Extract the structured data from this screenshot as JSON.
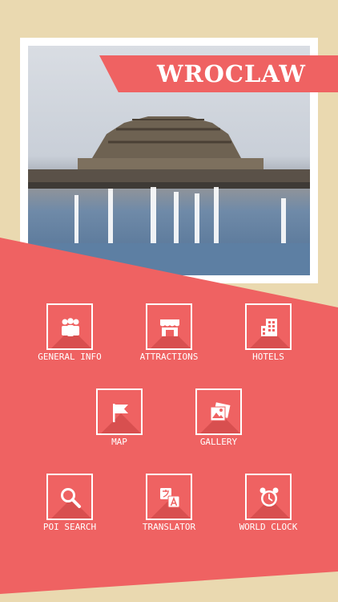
{
  "header": {
    "title": "WROCLAW"
  },
  "menu": {
    "general_info": "GENERAL INFO",
    "attractions": "ATTRACTIONS",
    "hotels": "HOTELS",
    "map": "MAP",
    "gallery": "GALLERY",
    "poi_search": "POI SEARCH",
    "translator": "TRANSLATOR",
    "world_clock": "WORLD CLOCK"
  },
  "icons": {
    "general_info": "people-group-icon",
    "attractions": "store-awning-icon",
    "hotels": "building-icon",
    "map": "flag-icon",
    "gallery": "photos-icon",
    "poi_search": "magnifier-icon",
    "translator": "translate-icon",
    "world_clock": "alarm-clock-icon"
  },
  "colors": {
    "accent": "#ef6262",
    "background": "#ead9b0",
    "card": "#ffffff"
  }
}
